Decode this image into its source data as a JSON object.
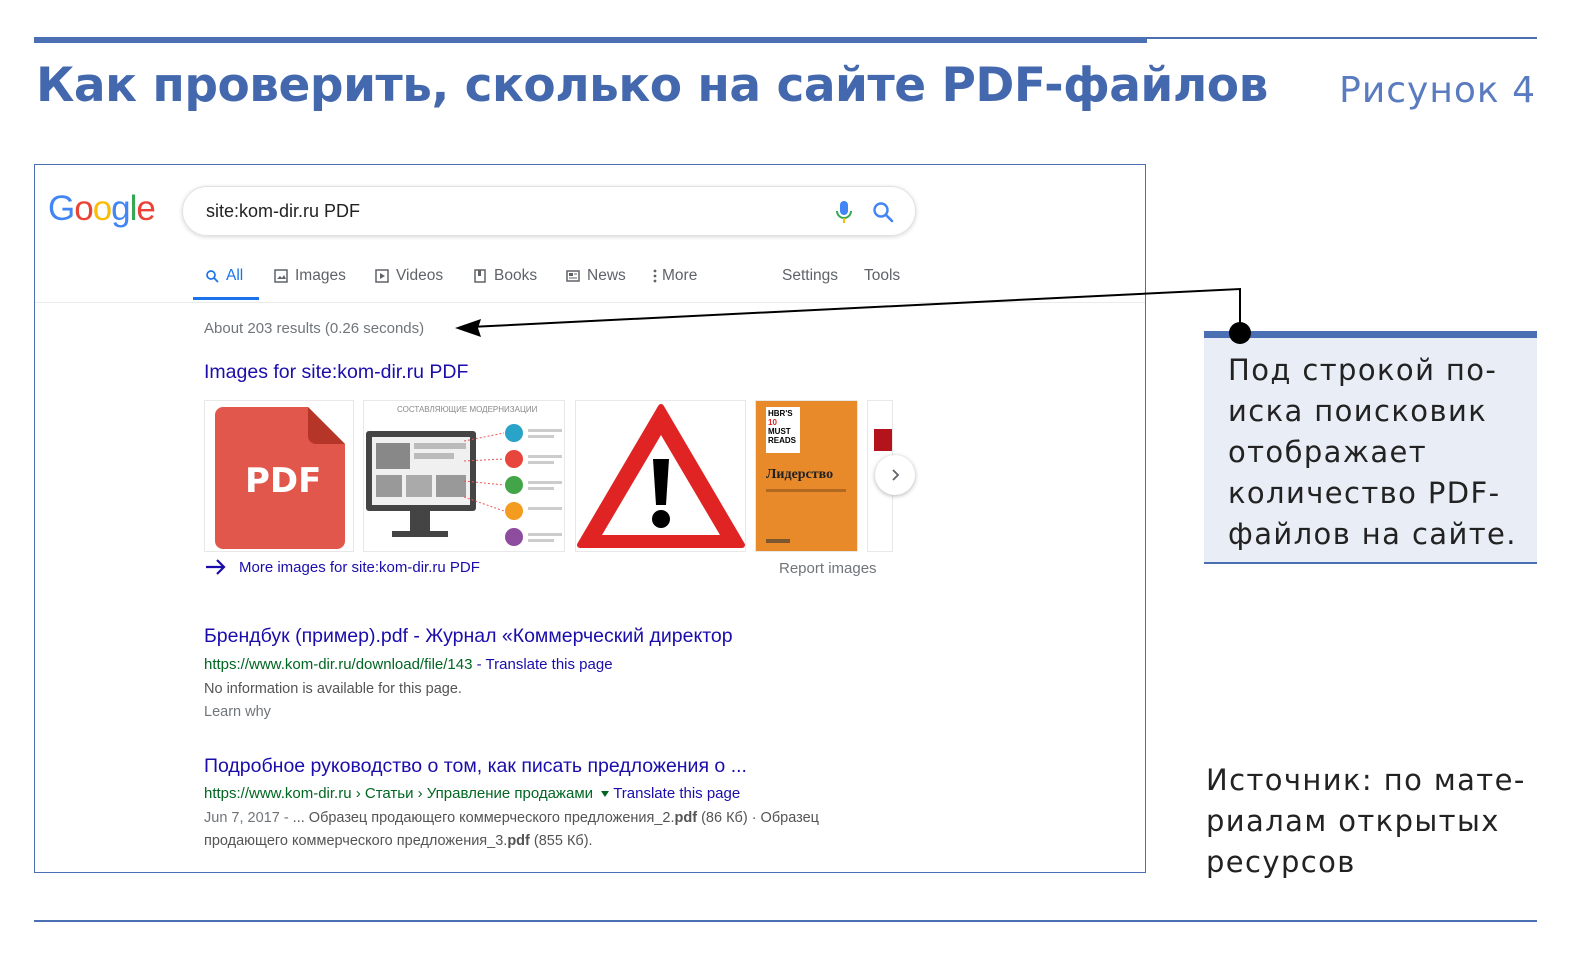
{
  "figure": {
    "title": "Как проверить, сколько на сайте PDF-файлов",
    "number": "Рисунок 4",
    "callout": "Под строкой по-\nиска поисковик\nотображает\nколичество PDF-\nфайлов на сайте.",
    "source": "Источник: по мате-\nриалам открытых\nресурсов",
    "accent_color": "#4a6fb3"
  },
  "google": {
    "logo_letters": [
      "G",
      "o",
      "o",
      "g",
      "l",
      "e"
    ],
    "search_query": "site:kom-dir.ru PDF",
    "tabs": [
      "All",
      "Images",
      "Videos",
      "Books",
      "News",
      "More",
      "Settings",
      "Tools"
    ],
    "result_stats": "About 203 results (0.26 seconds)",
    "images_heading": "Images for site:kom-dir.ru PDF",
    "thumbs": {
      "pdf_label": "PDF",
      "infographic_caption": "СОСТАВЛЯЮЩИЕ МОДЕРНИЗАЦИИ",
      "book_series": [
        "HBR'S",
        "10",
        "MUST",
        "READS"
      ],
      "book_title": "Лидерство"
    },
    "more_images": "More images for site:kom-dir.ru PDF",
    "report_images": "Report images",
    "results": [
      {
        "title": "Брендбук (пример).pdf - Журнал «Коммерческий директор",
        "url": "https://www.kom-dir.ru/download/file/143",
        "translate": " - Translate this page",
        "snippet1": "No information is available for this page.",
        "snippet2": "Learn why"
      },
      {
        "title": "Подробное руководство о том, как писать предложения о ...",
        "url": "https://www.kom-dir.ru › Статьи › Управление продажами",
        "translate": "Translate this page",
        "date": "Jun 7, 2017 - ",
        "snippet1": "... Образец продающего коммерческого предложения_2.",
        "bold1": "pdf",
        "snippet1b": " (86 Кб) · Образец",
        "snippet2": "продающего коммерческого предложения_3.",
        "bold2": "pdf",
        "snippet2b": " (855 Кб)."
      }
    ]
  }
}
